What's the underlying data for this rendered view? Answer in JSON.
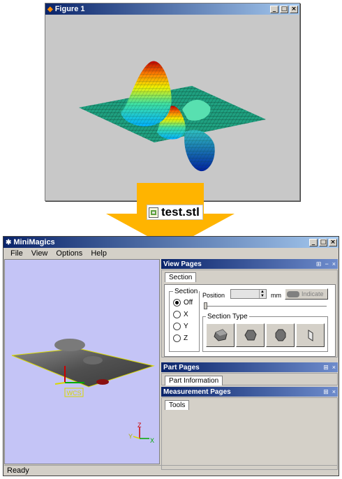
{
  "figure_window": {
    "title": "Figure 1",
    "controls": [
      "_",
      "□",
      "×"
    ]
  },
  "transfer_label": {
    "filename": "test.stl",
    "icon": "stl-file-icon"
  },
  "app_window": {
    "title": "MiniMagics",
    "controls": [
      "_",
      "□",
      "×"
    ],
    "menu": [
      "File",
      "View",
      "Options",
      "Help"
    ],
    "status": "Ready",
    "viewport": {
      "wcs_label": "WCS",
      "axis_labels": {
        "x": "X",
        "y": "Y",
        "z": "Z"
      },
      "axis_colors": {
        "x": "#00aa00",
        "y": "#d8d800",
        "z": "#cc0000"
      },
      "background": "#c4c4f6"
    },
    "view_pages": {
      "header": "View Pages",
      "header_controls": [
        "⊞",
        "−",
        "×"
      ],
      "tab": "Section",
      "section_group": {
        "legend": "Section",
        "options": [
          "Off",
          "X",
          "Y",
          "Z"
        ],
        "selected": "Off"
      },
      "position_label": "Position",
      "position_unit": "mm",
      "indicate_label": "Indicate",
      "section_type_legend": "Section Type"
    },
    "part_pages": {
      "header": "Part Pages",
      "tab": "Part Information"
    },
    "measurement_pages": {
      "header": "Measurement Pages",
      "tab": "Tools"
    }
  },
  "colors": {
    "arrow": "#ffb400",
    "titlebar_start": "#0a246a",
    "titlebar_end": "#a6caf0",
    "surface_base": "#1a9a6a"
  }
}
